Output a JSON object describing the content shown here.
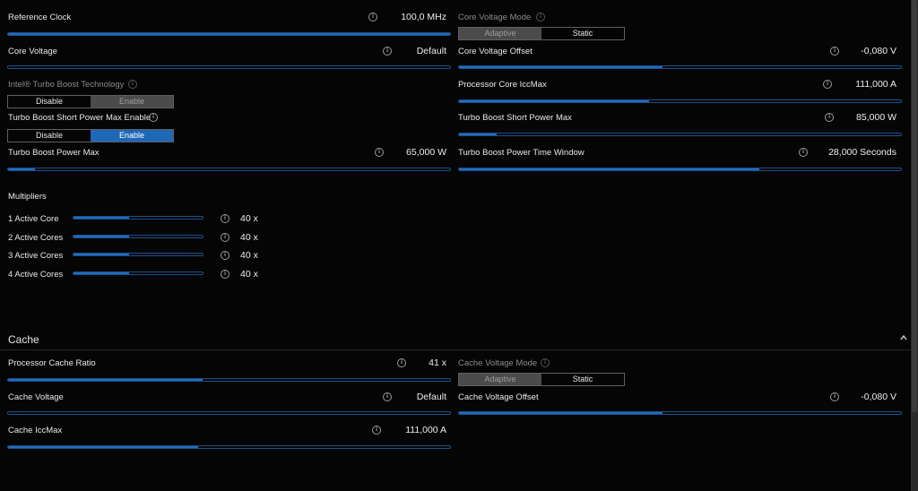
{
  "core": {
    "reference_clock": {
      "label": "Reference Clock",
      "value": "100,0 MHz",
      "fill": 1.0
    },
    "core_voltage_mode": {
      "label": "Core Voltage Mode",
      "options": [
        "Adaptive",
        "Static"
      ],
      "selected": "Adaptive"
    },
    "core_voltage": {
      "label": "Core Voltage",
      "value": "Default",
      "fill": 0.0
    },
    "core_voltage_offset": {
      "label": "Core Voltage Offset",
      "value": "-0,080 V",
      "fill": 0.46
    },
    "turbo_boost_tech": {
      "label": "Intel® Turbo Boost Technology",
      "options": [
        "Disable",
        "Enable"
      ],
      "selected": "Enable"
    },
    "processor_core_iccmax": {
      "label": "Processor Core IccMax",
      "value": "111,000 A",
      "fill": 0.43
    },
    "turbo_short_power_max_enable": {
      "label": "Turbo Boost Short Power Max Enable",
      "options": [
        "Disable",
        "Enable"
      ],
      "selected": "Enable"
    },
    "turbo_short_power_max": {
      "label": "Turbo Boost Short Power Max",
      "value": "85,000 W",
      "fill": 0.085
    },
    "turbo_power_max": {
      "label": "Turbo Boost Power Max",
      "value": "65,000 W",
      "fill": 0.06
    },
    "turbo_power_time_window": {
      "label": "Turbo Boost Power Time Window",
      "value": "28,000 Seconds",
      "fill": 0.68
    }
  },
  "multipliers": {
    "heading": "Multipliers",
    "rows": [
      {
        "label": "1 Active Core",
        "value": "40 x",
        "fill": 0.43
      },
      {
        "label": "2 Active Cores",
        "value": "40 x",
        "fill": 0.43
      },
      {
        "label": "3 Active Cores",
        "value": "40 x",
        "fill": 0.43
      },
      {
        "label": "4 Active Cores",
        "value": "40 x",
        "fill": 0.43
      }
    ]
  },
  "cache": {
    "heading": "Cache",
    "collapse_icon": "chevron-up-icon",
    "processor_cache_ratio": {
      "label": "Processor Cache Ratio",
      "value": "41 x",
      "fill": 0.44
    },
    "cache_voltage_mode": {
      "label": "Cache Voltage Mode",
      "options": [
        "Adaptive",
        "Static"
      ],
      "selected": "Adaptive"
    },
    "cache_voltage": {
      "label": "Cache Voltage",
      "value": "Default",
      "fill": 0.0
    },
    "cache_voltage_offset": {
      "label": "Cache Voltage Offset",
      "value": "-0,080 V",
      "fill": 0.46
    },
    "cache_iccmax": {
      "label": "Cache IccMax",
      "value": "111,000 A",
      "fill": 0.43
    }
  },
  "colors": {
    "accent": "#1f68b8",
    "background": "#050505",
    "slider_border": "#1d4f86"
  },
  "icons": {
    "info": "info-icon"
  }
}
